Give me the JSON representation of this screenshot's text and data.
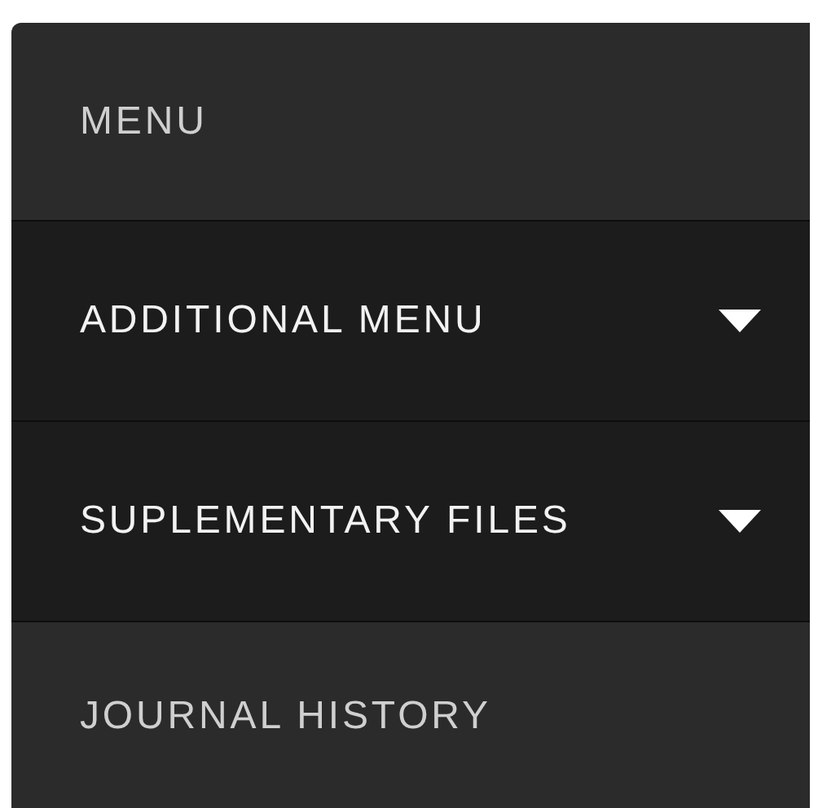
{
  "menu": {
    "items": [
      {
        "label": "MENU",
        "kind": "heading"
      },
      {
        "label": "ADDITIONAL MENU",
        "kind": "dropdown"
      },
      {
        "label": "SUPLEMENTARY FILES",
        "kind": "dropdown"
      },
      {
        "label": "JOURNAL HISTORY",
        "kind": "link"
      }
    ]
  }
}
